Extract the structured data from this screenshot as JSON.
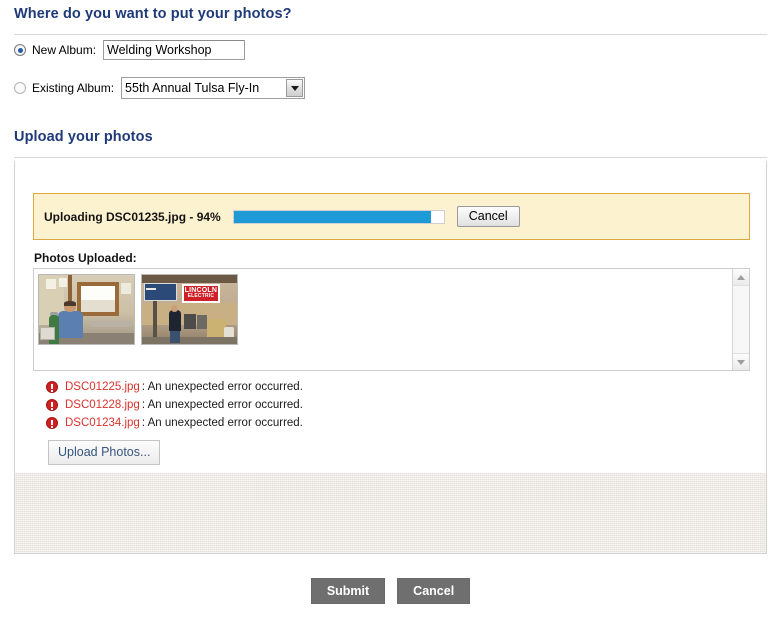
{
  "destination": {
    "heading": "Where do you want to put your photos?",
    "new_album": {
      "label": "New Album:",
      "value": "Welding Workshop",
      "selected": true
    },
    "existing_album": {
      "label": "Existing Album:",
      "value": "55th Annual Tulsa Fly-In",
      "selected": false
    }
  },
  "upload": {
    "heading": "Upload your photos",
    "progress": {
      "label": "Uploading DSC01235.jpg - 94%",
      "percent": 94,
      "cancel_label": "Cancel"
    },
    "photos_uploaded_label": "Photos Uploaded:",
    "thumbnails": [
      {
        "alt": "man-in-blue-shirt-by-window"
      },
      {
        "alt": "lincoln-electric-sign-shop",
        "sign_line1": "LINCOLN",
        "sign_line2": "ELECTRIC"
      }
    ],
    "errors": [
      {
        "file": "DSC01225.jpg",
        "message": ": An unexpected error occurred."
      },
      {
        "file": "DSC01228.jpg",
        "message": ": An unexpected error occurred."
      },
      {
        "file": "DSC01234.jpg",
        "message": ": An unexpected error occurred."
      }
    ],
    "upload_button_label": "Upload Photos..."
  },
  "footer": {
    "submit_label": "Submit",
    "cancel_label": "Cancel"
  },
  "colors": {
    "heading": "#1f3a78",
    "progress_fill": "#1e9ad6",
    "notice_background": "#fdf2d0",
    "notice_border": "#dca744",
    "error_text": "#d8332e",
    "footer_button": "#6f6f6f"
  }
}
